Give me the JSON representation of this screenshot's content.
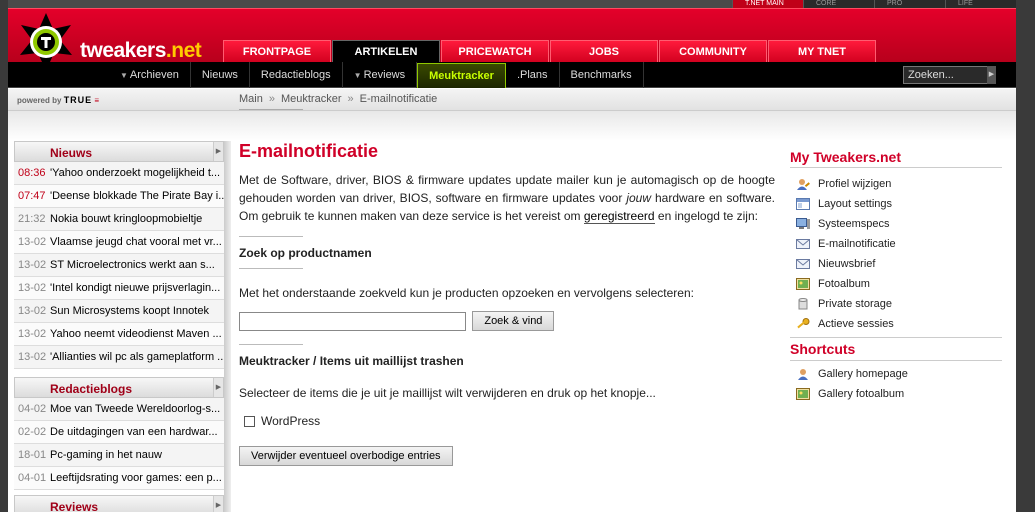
{
  "site_tabs": [
    "T.NET MAIN",
    "CORE",
    "PRO",
    "LIFE"
  ],
  "logo": {
    "name": "tweakers",
    "suffix": ".net"
  },
  "main_nav": [
    "FRONTPAGE",
    "ARTIKELEN",
    "PRICEWATCH",
    "JOBS",
    "COMMUNITY",
    "MY TNET"
  ],
  "sub_nav": [
    "Archieven",
    "Nieuws",
    "Redactieblogs",
    "Reviews",
    "Meuktracker",
    ".Plans",
    "Benchmarks"
  ],
  "search_placeholder": "Zoeken...",
  "powered": {
    "prefix": "powered by",
    "brand": "TRUE"
  },
  "breadcrumb": [
    "Main",
    "Meuktracker",
    "E-mailnotificatie"
  ],
  "nieuws": {
    "title": "Nieuws",
    "items": [
      {
        "time": "08:36",
        "headline": "'Yahoo onderzoekt mogelijkheid t..."
      },
      {
        "time": "07:47",
        "headline": "'Deense blokkade The Pirate Bay i..."
      },
      {
        "time": "21:32",
        "headline": "Nokia bouwt kringloopmobieltje"
      },
      {
        "time": "13-02",
        "headline": "Vlaamse jeugd chat vooral met vr..."
      },
      {
        "time": "13-02",
        "headline": "ST Microelectronics werkt aan s..."
      },
      {
        "time": "13-02",
        "headline": "'Intel kondigt nieuwe prijsverlagin..."
      },
      {
        "time": "13-02",
        "headline": "Sun Microsystems koopt Innotek"
      },
      {
        "time": "13-02",
        "headline": "Yahoo neemt videodienst Maven ..."
      },
      {
        "time": "13-02",
        "headline": "'Allianties wil pc als gameplatform ..."
      }
    ]
  },
  "redactieblogs": {
    "title": "Redactieblogs",
    "items": [
      {
        "time": "04-02",
        "headline": "Moe van Tweede Wereldoorlog-s..."
      },
      {
        "time": "02-02",
        "headline": "De uitdagingen van een hardwar..."
      },
      {
        "time": "18-01",
        "headline": "Pc-gaming in het nauw"
      },
      {
        "time": "04-01",
        "headline": "Leeftijdsrating voor games: een p..."
      }
    ]
  },
  "reviews": {
    "title": "Reviews"
  },
  "content": {
    "title": "E-mailnotificatie",
    "intro_1": "Met de Software, driver, BIOS & firmware updates update mailer kun je automagisch op de hoogte gehouden worden van driver, BIOS, software en firmware updates voor ",
    "intro_em": "jouw",
    "intro_2": " hardware en software. Om gebruik te kunnen maken van deze service is het vereist om ",
    "intro_link": "geregistreerd",
    "intro_3": " en ingelogd te zijn:",
    "section1_title": "Zoek op productnamen",
    "section1_text": "Met het onderstaande zoekveld kun je producten opzoeken en vervolgens selecteren:",
    "search_button": "Zoek & vind",
    "section2_title": "Meuktracker / Items uit maillijst trashen",
    "section2_text": "Selecteer de items die je uit je maillijst wilt verwijderen en druk op het knopje...",
    "checkbox_label": "WordPress",
    "remove_button": "Verwijder eventueel overbodige entries"
  },
  "my_tweakers": {
    "title": "My Tweakers.net",
    "items": [
      {
        "label": "Profiel wijzigen",
        "icon": "user-edit-icon"
      },
      {
        "label": "Layout settings",
        "icon": "layout-icon"
      },
      {
        "label": "Systeemspecs",
        "icon": "computer-icon"
      },
      {
        "label": "E-mailnotificatie",
        "icon": "envelope-icon"
      },
      {
        "label": "Nieuwsbrief",
        "icon": "envelope-icon"
      },
      {
        "label": "Fotoalbum",
        "icon": "picture-icon"
      },
      {
        "label": "Private storage",
        "icon": "database-icon"
      },
      {
        "label": "Actieve sessies",
        "icon": "key-icon"
      }
    ]
  },
  "shortcuts": {
    "title": "Shortcuts",
    "items": [
      {
        "label": "Gallery homepage",
        "icon": "user-icon"
      },
      {
        "label": "Gallery fotoalbum",
        "icon": "picture-icon"
      }
    ]
  },
  "colors": {
    "brand_red": "#e4002a",
    "title_red": "#d00028",
    "meuk_green": "#c8ff00"
  }
}
